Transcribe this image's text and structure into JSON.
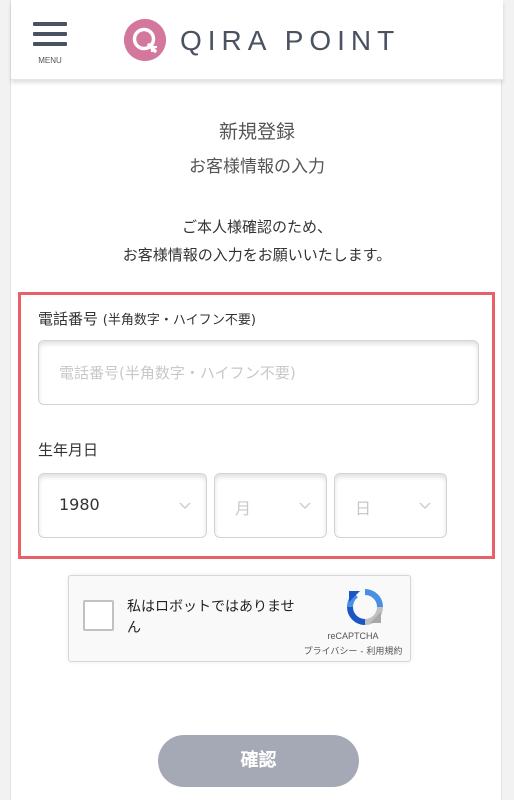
{
  "header": {
    "menu_label": "MENU",
    "logo_text": "QIRA POINT",
    "brand_color": "#d3779c"
  },
  "page": {
    "title": "新規登録",
    "subtitle": "お客様情報の入力",
    "intro_line1": "ご本人様確認のため、",
    "intro_line2": "お客様情報の入力をお願いいたします。"
  },
  "form": {
    "phone": {
      "label": "電話番号",
      "note": "(半角数字・ハイフン不要)",
      "placeholder": "電話番号(半角数字・ハイフン不要)",
      "value": ""
    },
    "birthdate": {
      "label": "生年月日",
      "year": "1980",
      "month_placeholder": "月",
      "day_placeholder": "日"
    },
    "highlight_color": "#e86068"
  },
  "recaptcha": {
    "text": "私はロボットではありません",
    "brand": "reCAPTCHA",
    "privacy": "プライバシー",
    "separator": " - ",
    "terms": "利用規約",
    "checked": false
  },
  "actions": {
    "confirm_label": "確認"
  }
}
